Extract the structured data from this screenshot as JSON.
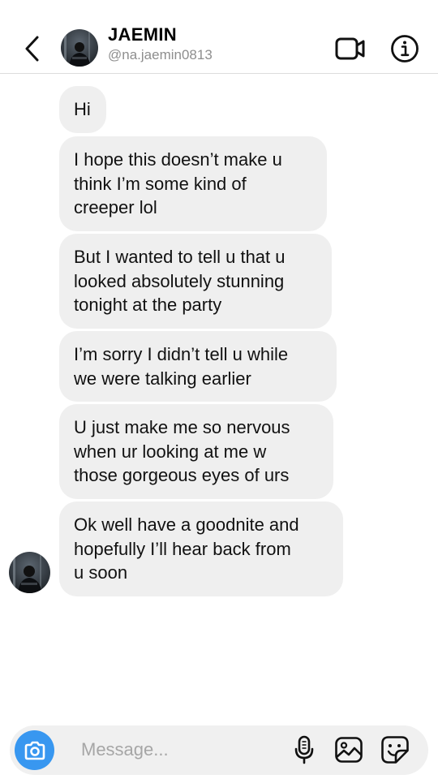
{
  "header": {
    "name": "JAEMIN",
    "handle": "@na.jaemin0813"
  },
  "messages": [
    {
      "text": "Hi"
    },
    {
      "text": "I hope this doesn’t make u\nthink I’m some kind of\ncreeper lol"
    },
    {
      "text": "But I wanted to tell u that u\nlooked absolutely stunning\ntonight at the party"
    },
    {
      "text": "I’m sorry I didn’t tell u while\nwe were talking earlier"
    },
    {
      "text": "U just make me so nervous\nwhen ur looking at me w\nthose gorgeous eyes of urs"
    },
    {
      "text": "Ok well have a goodnite and\nhopefully I’ll hear back from\nu soon"
    }
  ],
  "composer": {
    "placeholder": "Message..."
  },
  "icons": {
    "back": "chevron-left-icon",
    "video": "video-camera-icon",
    "info": "info-icon",
    "camera": "camera-icon",
    "mic": "microphone-icon",
    "gallery": "image-icon",
    "sticker": "sticker-icon"
  },
  "colors": {
    "accent": "#3897f0",
    "bubble": "#efefef",
    "secondary_text": "#8e8e8e"
  }
}
